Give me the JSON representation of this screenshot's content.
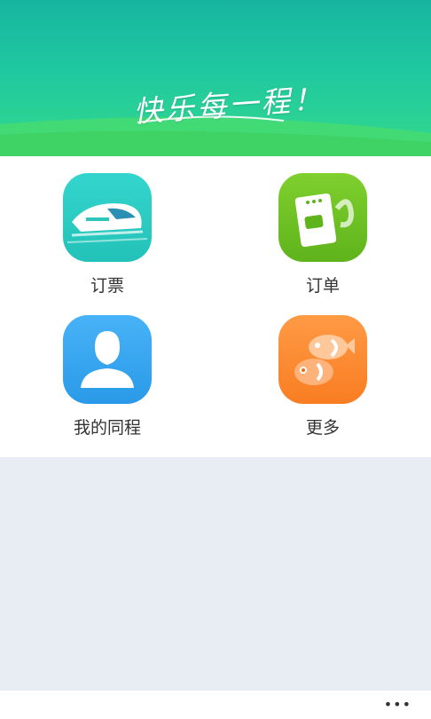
{
  "banner": {
    "slogan": "快乐每一程！"
  },
  "menu": [
    {
      "label": "订票",
      "icon": "train-icon",
      "color": "#2cccc3"
    },
    {
      "label": "订单",
      "icon": "ticket-icon",
      "color": "#6cc224"
    },
    {
      "label": "我的同程",
      "icon": "user-icon",
      "color": "#38a7f0"
    },
    {
      "label": "更多",
      "icon": "fish-icon",
      "color": "#fb8a30"
    }
  ],
  "footer": {
    "more_glyph": "•••"
  }
}
